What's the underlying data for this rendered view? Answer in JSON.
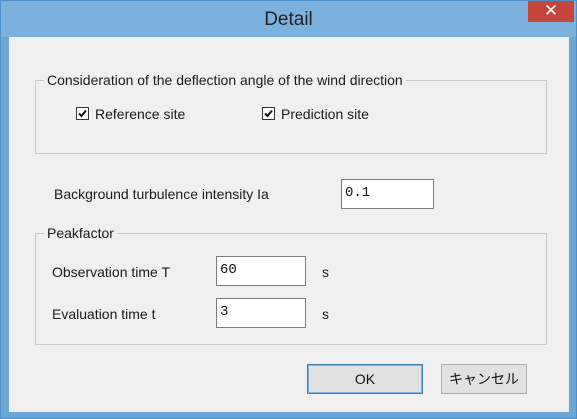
{
  "window": {
    "title": "Detail",
    "close_symbol": "✕"
  },
  "deflection_group": {
    "legend": "Consideration of the deflection angle of the wind direction",
    "reference_site": {
      "label": "Reference site",
      "checked": true
    },
    "prediction_site": {
      "label": "Prediction site",
      "checked": true
    }
  },
  "background_turbulence": {
    "label": "Background turbulence intensity Ia",
    "value": "0.1"
  },
  "peakfactor_group": {
    "legend": "Peakfactor",
    "observation_time": {
      "label": "Observation time T",
      "value": "60",
      "unit": "s"
    },
    "evaluation_time": {
      "label": "Evaluation time t",
      "value": "3",
      "unit": "s"
    }
  },
  "buttons": {
    "ok": "OK",
    "cancel": "キャンセル"
  },
  "icons": {
    "close": "close-icon",
    "check": "check-icon"
  },
  "colors": {
    "title_bar": "#7cb1dd",
    "close_button": "#c7463c",
    "dialog_background": "#f0f0f0"
  }
}
